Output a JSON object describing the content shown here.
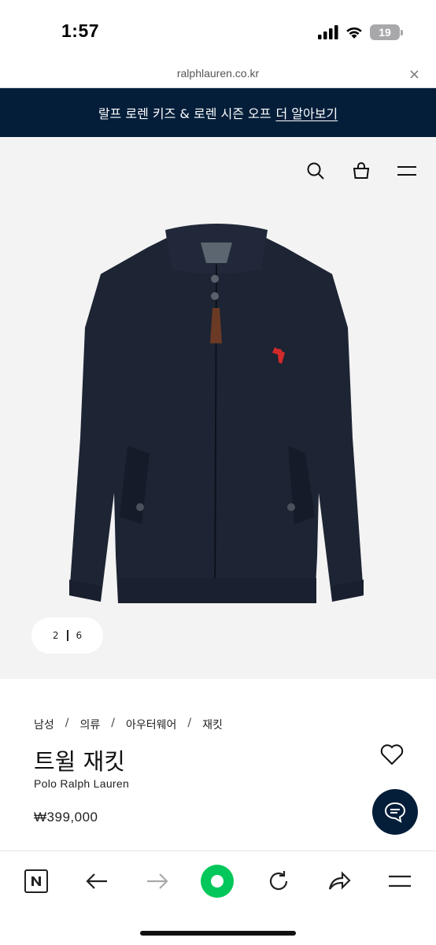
{
  "status": {
    "time": "1:57",
    "battery": "19"
  },
  "browser": {
    "url": "ralphlauren.co.kr",
    "close": "×"
  },
  "promo": {
    "text": "랄프 로렌 키즈 & 로렌 시즌 오프",
    "link": "더 알아보기"
  },
  "header_icons": [
    "search-icon",
    "shopping-bag-icon",
    "menu-icon"
  ],
  "gallery": {
    "current": "2",
    "total": "6"
  },
  "product": {
    "breadcrumb": [
      "남성",
      "의류",
      "아우터웨어",
      "재킷"
    ],
    "title": "트윌 재킷",
    "brand": "Polo Ralph Lauren",
    "price": "₩399,000"
  },
  "toolbar": [
    "naver-icon",
    "back-icon",
    "forward-icon",
    "green-dot-icon",
    "refresh-icon",
    "share-icon",
    "menu-icon"
  ],
  "colors": {
    "navy": "#041e3a",
    "jacket": "#1d2433",
    "accent_green": "#03c75a",
    "logo_red": "#d22a2a"
  }
}
